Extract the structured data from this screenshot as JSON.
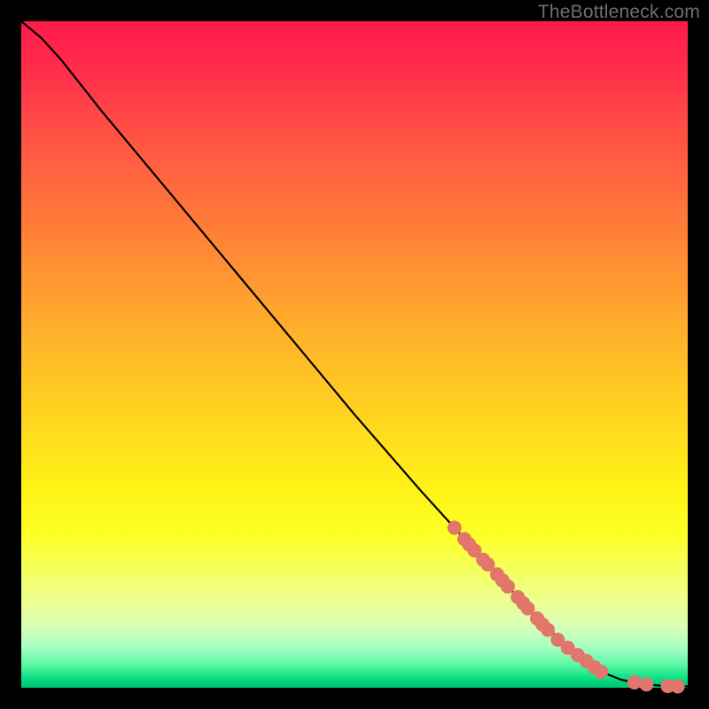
{
  "watermark": "TheBottleneck.com",
  "chart_data": {
    "type": "line",
    "title": "",
    "xlabel": "",
    "ylabel": "",
    "xlim": [
      0,
      100
    ],
    "ylim": [
      0,
      100
    ],
    "grid": false,
    "curve": [
      {
        "x": 0,
        "y": 100
      },
      {
        "x": 3,
        "y": 97.5
      },
      {
        "x": 6,
        "y": 94.2
      },
      {
        "x": 9,
        "y": 90.4
      },
      {
        "x": 12,
        "y": 86.6
      },
      {
        "x": 20,
        "y": 77.0
      },
      {
        "x": 30,
        "y": 65.0
      },
      {
        "x": 40,
        "y": 53.0
      },
      {
        "x": 50,
        "y": 41.0
      },
      {
        "x": 60,
        "y": 29.5
      },
      {
        "x": 65,
        "y": 24.0
      },
      {
        "x": 70,
        "y": 18.5
      },
      {
        "x": 75,
        "y": 13.0
      },
      {
        "x": 80,
        "y": 8.0
      },
      {
        "x": 84,
        "y": 4.5
      },
      {
        "x": 87,
        "y": 2.4
      },
      {
        "x": 90,
        "y": 1.2
      },
      {
        "x": 93,
        "y": 0.6
      },
      {
        "x": 96,
        "y": 0.3
      },
      {
        "x": 100,
        "y": 0.2
      }
    ],
    "points": [
      {
        "x": 65.0,
        "y": 24.0
      },
      {
        "x": 66.5,
        "y": 22.3
      },
      {
        "x": 67.2,
        "y": 21.5
      },
      {
        "x": 68.0,
        "y": 20.6
      },
      {
        "x": 69.3,
        "y": 19.2
      },
      {
        "x": 70.0,
        "y": 18.5
      },
      {
        "x": 71.4,
        "y": 17.0
      },
      {
        "x": 72.2,
        "y": 16.1
      },
      {
        "x": 73.0,
        "y": 15.2
      },
      {
        "x": 74.5,
        "y": 13.6
      },
      {
        "x": 75.3,
        "y": 12.7
      },
      {
        "x": 76.0,
        "y": 11.9
      },
      {
        "x": 77.4,
        "y": 10.4
      },
      {
        "x": 78.2,
        "y": 9.5
      },
      {
        "x": 79.0,
        "y": 8.7
      },
      {
        "x": 80.5,
        "y": 7.2
      },
      {
        "x": 82.0,
        "y": 6.0
      },
      {
        "x": 83.5,
        "y": 4.9
      },
      {
        "x": 84.8,
        "y": 4.0
      },
      {
        "x": 86.0,
        "y": 3.1
      },
      {
        "x": 87.0,
        "y": 2.4
      },
      {
        "x": 92.0,
        "y": 0.8
      },
      {
        "x": 93.8,
        "y": 0.5
      },
      {
        "x": 97.0,
        "y": 0.25
      },
      {
        "x": 98.5,
        "y": 0.2
      }
    ],
    "point_color": "#e2766c",
    "line_color": "#000000",
    "point_radius_px": 8
  }
}
